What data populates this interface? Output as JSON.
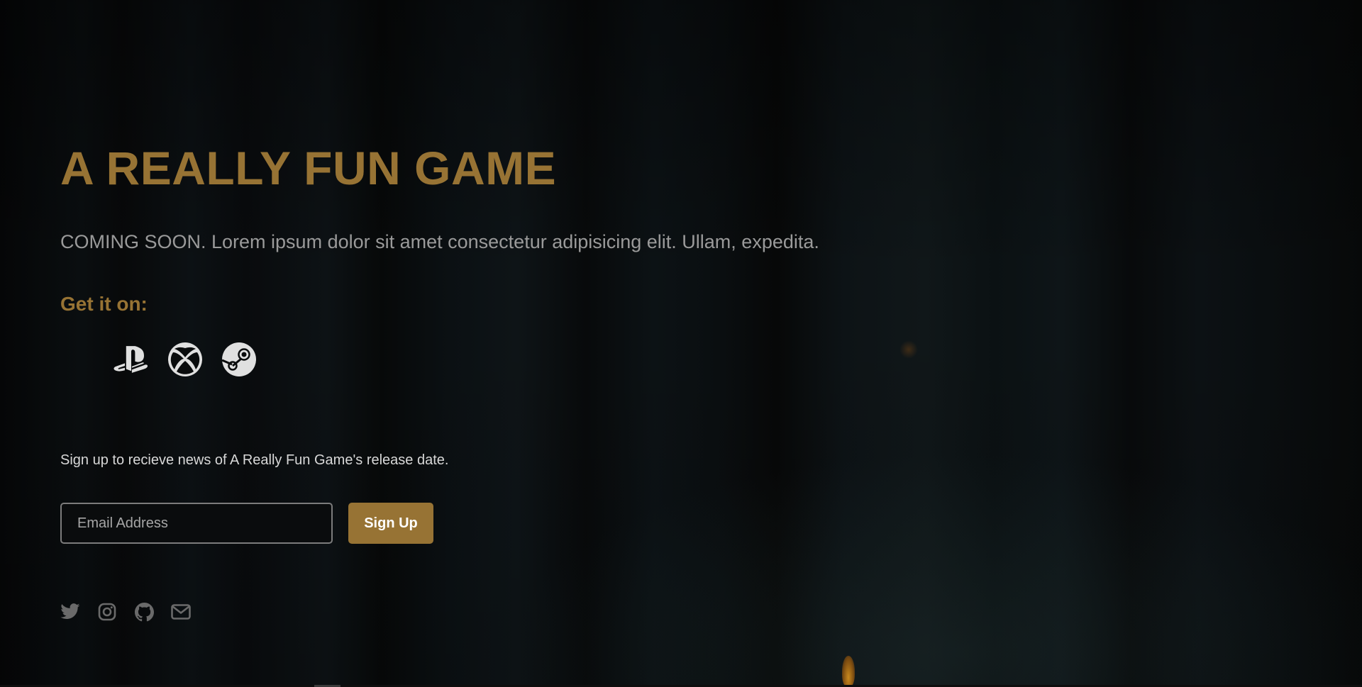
{
  "colors": {
    "accent": "#977334",
    "icon_light": "#e0e0e0",
    "icon_muted": "#6a6a6a"
  },
  "hero": {
    "title": "A REALLY FUN GAME",
    "tagline": "COMING SOON. Lorem ipsum dolor sit amet consectetur adipisicing elit. Ullam, expedita."
  },
  "platforms": {
    "heading": "Get it on:",
    "items": [
      {
        "icon": "playstation-icon"
      },
      {
        "icon": "xbox-icon"
      },
      {
        "icon": "steam-icon"
      }
    ]
  },
  "signup": {
    "text": "Sign up to recieve news of A Really Fun Game's release date.",
    "email_placeholder": "Email Address",
    "button_label": "Sign Up"
  },
  "socials": [
    {
      "icon": "twitter-icon"
    },
    {
      "icon": "instagram-icon"
    },
    {
      "icon": "github-icon"
    },
    {
      "icon": "mail-icon"
    }
  ]
}
